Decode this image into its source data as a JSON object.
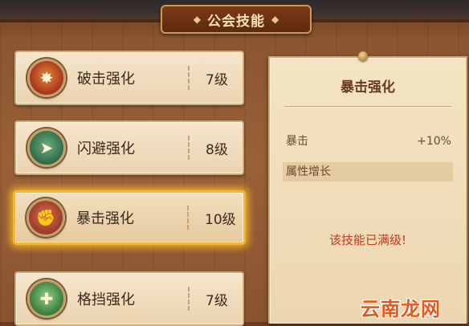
{
  "header": {
    "title": "公会技能",
    "deco_left": "◆",
    "deco_right": "◆"
  },
  "skills": [
    {
      "name": "破击强化",
      "level": "7级",
      "icon": "burst-strike-icon",
      "symbol": "✸",
      "color": "#a8321c",
      "selected": false
    },
    {
      "name": "闪避强化",
      "level": "8级",
      "icon": "dodge-figure-icon",
      "symbol": "➤",
      "color": "#2e6a4a",
      "selected": false
    },
    {
      "name": "暴击强化",
      "level": "10级",
      "icon": "fist-icon",
      "symbol": "✊",
      "color": "#9a3a2a",
      "selected": true
    },
    {
      "name": "格挡强化",
      "level": "7级",
      "icon": "shield-block-icon",
      "symbol": "✚",
      "color": "#3a7a3a",
      "selected": false
    }
  ],
  "detail": {
    "title": "暴击强化",
    "stat_label": "暴击",
    "stat_value": "+10%",
    "growth_label": "属性增长",
    "maxed_text": "该技能已满级!"
  },
  "scroll_icon": "chevron-down-icon",
  "watermark": "云南龙网"
}
